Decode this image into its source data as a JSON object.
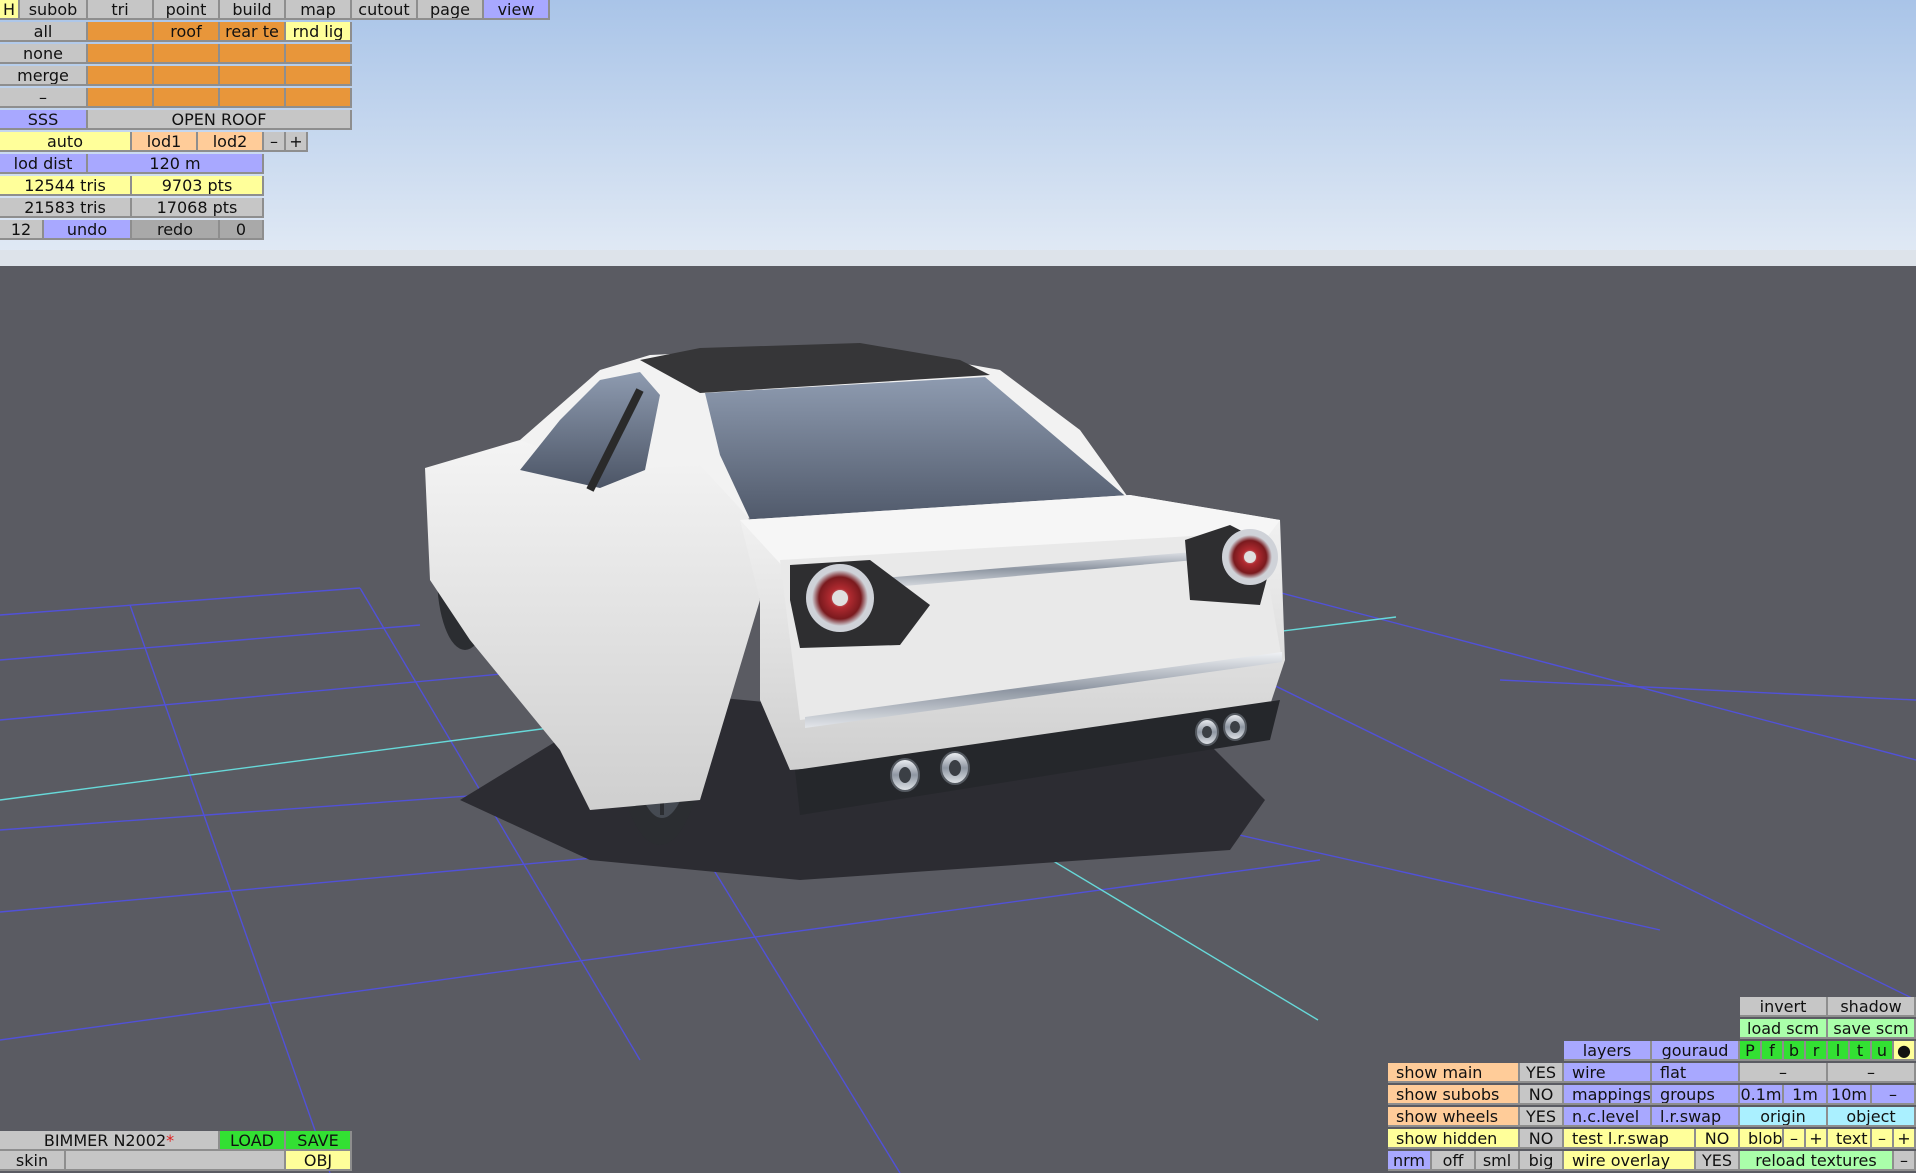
{
  "toolbar": {
    "h": "H",
    "tabs": [
      "subob",
      "tri",
      "point",
      "build",
      "map",
      "cutout",
      "page",
      "view"
    ]
  },
  "selection": {
    "all": "all",
    "none": "none",
    "merge": "merge",
    "minus": "–",
    "roof": "roof",
    "rear_te": "rear te",
    "rnd_lig": "rnd lig"
  },
  "sss": "SSS",
  "open_roof": "OPEN ROOF",
  "lod": {
    "auto": "auto",
    "lod1": "lod1",
    "lod2": "lod2",
    "minus": "–",
    "plus": "+",
    "dist_label": "lod dist",
    "dist_value": "120 m"
  },
  "stats": {
    "tris1": "12544 tris",
    "pts1": "9703 pts",
    "tris2": "21583 tris",
    "pts2": "17068 pts"
  },
  "history": {
    "count": "12",
    "undo": "undo",
    "redo": "redo",
    "redo_count": "0"
  },
  "file": {
    "name": "BIMMER N2002",
    "modified_mark": "*",
    "load": "LOAD",
    "save": "SAVE",
    "skin": "skin",
    "obj": "OBJ"
  },
  "view_panel": {
    "invert": "invert",
    "shadow": "shadow",
    "load_scm": "load scm",
    "save_scm": "save scm",
    "flags": [
      "P",
      "f",
      "b",
      "r",
      "l",
      "t",
      "u",
      "●"
    ],
    "minus1": "–",
    "minus2": "–",
    "layers": "layers",
    "gouraud": "gouraud",
    "wire": "wire",
    "flat": "flat",
    "mappings": "mappings",
    "groups": "groups",
    "n_c_level": "n.c.level",
    "l_r_swap": "l.r.swap",
    "test_lr_swap": "test l.r.swap",
    "test_lr_swap_value": "NO",
    "wire_overlay": "wire overlay",
    "wire_overlay_value": "YES",
    "show_main": "show main",
    "show_main_value": "YES",
    "show_subobs": "show subobs",
    "show_subobs_value": "NO",
    "show_wheels": "show wheels",
    "show_wheels_value": "YES",
    "show_hidden": "show hidden",
    "show_hidden_value": "NO",
    "nrm": "nrm",
    "off": "off",
    "sml": "sml",
    "big": "big",
    "grid_01": "0.1m",
    "grid_1": "1m",
    "grid_10": "10m",
    "grid_minus": "–",
    "origin": "origin",
    "object": "object",
    "blob": "blob",
    "blob_minus": "–",
    "blob_plus": "+",
    "text": "text",
    "text_minus": "–",
    "text_plus": "+",
    "reload_textures": "reload textures",
    "reload_minus": "–"
  },
  "colors": {
    "sky_top": "#a9c4e8",
    "sky_bottom": "#dfe8f4",
    "ground": "#5a5b62",
    "grid_line": "#5151d8",
    "axis_line": "#67d9d9",
    "car_body": "#e6e6e6"
  }
}
